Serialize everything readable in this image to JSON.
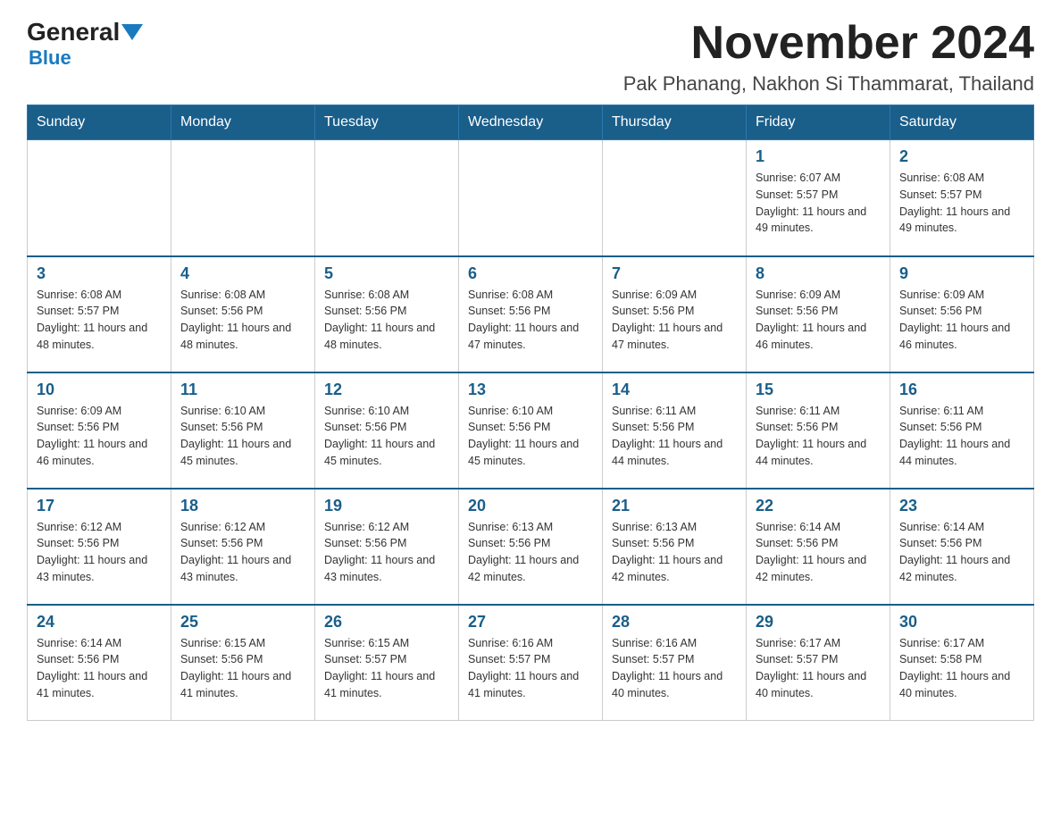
{
  "logo": {
    "general": "General",
    "blue": "Blue"
  },
  "header": {
    "month_year": "November 2024",
    "location": "Pak Phanang, Nakhon Si Thammarat, Thailand"
  },
  "weekdays": [
    "Sunday",
    "Monday",
    "Tuesday",
    "Wednesday",
    "Thursday",
    "Friday",
    "Saturday"
  ],
  "weeks": [
    [
      {
        "day": "",
        "info": ""
      },
      {
        "day": "",
        "info": ""
      },
      {
        "day": "",
        "info": ""
      },
      {
        "day": "",
        "info": ""
      },
      {
        "day": "",
        "info": ""
      },
      {
        "day": "1",
        "info": "Sunrise: 6:07 AM\nSunset: 5:57 PM\nDaylight: 11 hours and 49 minutes."
      },
      {
        "day": "2",
        "info": "Sunrise: 6:08 AM\nSunset: 5:57 PM\nDaylight: 11 hours and 49 minutes."
      }
    ],
    [
      {
        "day": "3",
        "info": "Sunrise: 6:08 AM\nSunset: 5:57 PM\nDaylight: 11 hours and 48 minutes."
      },
      {
        "day": "4",
        "info": "Sunrise: 6:08 AM\nSunset: 5:56 PM\nDaylight: 11 hours and 48 minutes."
      },
      {
        "day": "5",
        "info": "Sunrise: 6:08 AM\nSunset: 5:56 PM\nDaylight: 11 hours and 48 minutes."
      },
      {
        "day": "6",
        "info": "Sunrise: 6:08 AM\nSunset: 5:56 PM\nDaylight: 11 hours and 47 minutes."
      },
      {
        "day": "7",
        "info": "Sunrise: 6:09 AM\nSunset: 5:56 PM\nDaylight: 11 hours and 47 minutes."
      },
      {
        "day": "8",
        "info": "Sunrise: 6:09 AM\nSunset: 5:56 PM\nDaylight: 11 hours and 46 minutes."
      },
      {
        "day": "9",
        "info": "Sunrise: 6:09 AM\nSunset: 5:56 PM\nDaylight: 11 hours and 46 minutes."
      }
    ],
    [
      {
        "day": "10",
        "info": "Sunrise: 6:09 AM\nSunset: 5:56 PM\nDaylight: 11 hours and 46 minutes."
      },
      {
        "day": "11",
        "info": "Sunrise: 6:10 AM\nSunset: 5:56 PM\nDaylight: 11 hours and 45 minutes."
      },
      {
        "day": "12",
        "info": "Sunrise: 6:10 AM\nSunset: 5:56 PM\nDaylight: 11 hours and 45 minutes."
      },
      {
        "day": "13",
        "info": "Sunrise: 6:10 AM\nSunset: 5:56 PM\nDaylight: 11 hours and 45 minutes."
      },
      {
        "day": "14",
        "info": "Sunrise: 6:11 AM\nSunset: 5:56 PM\nDaylight: 11 hours and 44 minutes."
      },
      {
        "day": "15",
        "info": "Sunrise: 6:11 AM\nSunset: 5:56 PM\nDaylight: 11 hours and 44 minutes."
      },
      {
        "day": "16",
        "info": "Sunrise: 6:11 AM\nSunset: 5:56 PM\nDaylight: 11 hours and 44 minutes."
      }
    ],
    [
      {
        "day": "17",
        "info": "Sunrise: 6:12 AM\nSunset: 5:56 PM\nDaylight: 11 hours and 43 minutes."
      },
      {
        "day": "18",
        "info": "Sunrise: 6:12 AM\nSunset: 5:56 PM\nDaylight: 11 hours and 43 minutes."
      },
      {
        "day": "19",
        "info": "Sunrise: 6:12 AM\nSunset: 5:56 PM\nDaylight: 11 hours and 43 minutes."
      },
      {
        "day": "20",
        "info": "Sunrise: 6:13 AM\nSunset: 5:56 PM\nDaylight: 11 hours and 42 minutes."
      },
      {
        "day": "21",
        "info": "Sunrise: 6:13 AM\nSunset: 5:56 PM\nDaylight: 11 hours and 42 minutes."
      },
      {
        "day": "22",
        "info": "Sunrise: 6:14 AM\nSunset: 5:56 PM\nDaylight: 11 hours and 42 minutes."
      },
      {
        "day": "23",
        "info": "Sunrise: 6:14 AM\nSunset: 5:56 PM\nDaylight: 11 hours and 42 minutes."
      }
    ],
    [
      {
        "day": "24",
        "info": "Sunrise: 6:14 AM\nSunset: 5:56 PM\nDaylight: 11 hours and 41 minutes."
      },
      {
        "day": "25",
        "info": "Sunrise: 6:15 AM\nSunset: 5:56 PM\nDaylight: 11 hours and 41 minutes."
      },
      {
        "day": "26",
        "info": "Sunrise: 6:15 AM\nSunset: 5:57 PM\nDaylight: 11 hours and 41 minutes."
      },
      {
        "day": "27",
        "info": "Sunrise: 6:16 AM\nSunset: 5:57 PM\nDaylight: 11 hours and 41 minutes."
      },
      {
        "day": "28",
        "info": "Sunrise: 6:16 AM\nSunset: 5:57 PM\nDaylight: 11 hours and 40 minutes."
      },
      {
        "day": "29",
        "info": "Sunrise: 6:17 AM\nSunset: 5:57 PM\nDaylight: 11 hours and 40 minutes."
      },
      {
        "day": "30",
        "info": "Sunrise: 6:17 AM\nSunset: 5:58 PM\nDaylight: 11 hours and 40 minutes."
      }
    ]
  ]
}
